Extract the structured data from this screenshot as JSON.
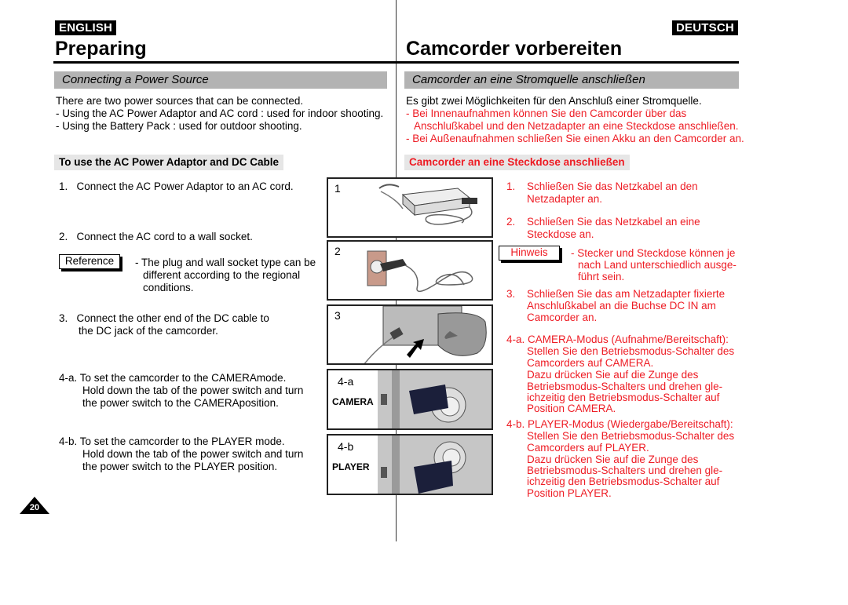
{
  "english": {
    "lang_badge": "ENGLISH",
    "title": "Preparing",
    "section": "Connecting a Power Source",
    "intro": [
      "There are two power sources that can be connected.",
      "- Using the AC Power Adaptor and AC cord : used for indoor shooting.",
      "- Using the Battery Pack : used for outdoor shooting."
    ],
    "subheading": "To use the AC Power Adaptor and DC Cable",
    "step1": "1.   Connect the AC Power Adaptor to an AC cord.",
    "step2": "2.   Connect the AC cord to a wall socket.",
    "reference_label": "Reference",
    "reference_lines": [
      "- The plug and wall socket type can be",
      "different according to the regional",
      "conditions."
    ],
    "step3": [
      "3.   Connect the other end of the DC cable to",
      "the DC jack of the camcorder."
    ],
    "step4a": [
      "4-a. To set the camcorder to the CAMERAmode.",
      "Hold down the tab of the power switch and turn",
      "the power switch to the CAMERAposition."
    ],
    "step4b": [
      "4-b. To set the camcorder to the PLAYER mode.",
      "Hold down the tab of the power switch and turn",
      "the power switch to the PLAYER position."
    ]
  },
  "deutsch": {
    "lang_badge": "DEUTSCH",
    "title": "Camcorder vorbereiten",
    "section": "Camcorder an eine Stromquelle anschließen",
    "intro": "Es gibt zwei Möglichkeiten für den Anschluß einer Stromquelle.",
    "intro_red": [
      "- Bei Innenaufnahmen können Sie den Camcorder über das",
      "Anschlußkabel und den Netzadapter an eine Steckdose anschließen.",
      "- Bei Außenaufnahmen schließen Sie einen Akku an den Camcorder an."
    ],
    "subheading": "Camcorder an eine Steckdose anschließen",
    "step1": [
      "1.",
      "Schließen Sie das Netzkabel an den",
      "Netzadapter an."
    ],
    "step2": [
      "2.",
      "Schließen Sie das Netzkabel an eine",
      "Steckdose an."
    ],
    "hinweis_label": "Hinweis",
    "hinweis_lines": [
      "- Stecker und Steckdose können je",
      "nach Land unterschiedlich ausge-",
      "führt sein."
    ],
    "step3": [
      "3.",
      "Schließen Sie das am Netzadapter fixierte",
      "Anschlußkabel an die Buchse DC IN am",
      "Camcorder an."
    ],
    "step4a": [
      "4-a. CAMERA-Modus (Aufnahme/Bereitschaft):",
      "Stellen Sie den Betriebsmodus-Schalter des",
      "Camcorders auf CAMERA.",
      "Dazu drücken Sie auf die Zunge des",
      "Betriebsmodus-Schalters und drehen gle-",
      "ichzeitig den Betriebsmodus-Schalter auf",
      "Position CAMERA."
    ],
    "step4b": [
      "4-b. PLAYER-Modus (Wiedergabe/Bereitschaft):",
      "Stellen Sie den Betriebsmodus-Schalter des",
      "Camcorders auf PLAYER.",
      "Dazu drücken Sie auf die Zunge des",
      "Betriebsmodus-Schalters und drehen gle-",
      "ichzeitig den Betriebsmodus-Schalter auf",
      "Position PLAYER."
    ]
  },
  "figures": [
    {
      "num": "1",
      "mode": ""
    },
    {
      "num": "2",
      "mode": ""
    },
    {
      "num": "3",
      "mode": ""
    },
    {
      "num": "4-a",
      "mode": "CAMERA"
    },
    {
      "num": "4-b",
      "mode": "PLAYER"
    }
  ],
  "page_number": "20",
  "colors": {
    "german_red": "#ee1c24",
    "section_bar": "#b3b3b3",
    "sub_bar": "#e6e6e6"
  }
}
